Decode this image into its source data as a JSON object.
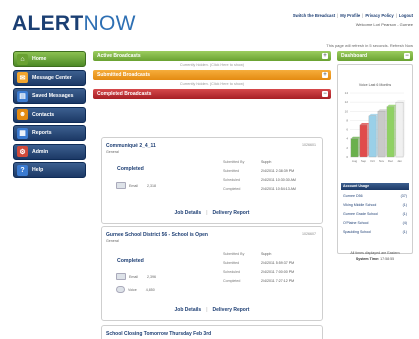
{
  "brand": {
    "name_part1": "ALERT",
    "name_part2": "NOW"
  },
  "header": {
    "links": [
      "Switch the Breadcast",
      "My Profile",
      "Privacy Policy",
      "Logout"
    ],
    "welcome": "Welcome Lori Pearson - Gurnee",
    "refresh_note": "This page will refresh in 5 seconds. Refresh Now"
  },
  "nav": [
    {
      "label": "Home",
      "icon": "home-icon",
      "color": "#6aa232"
    },
    {
      "label": "Message Center",
      "icon": "megaphone-icon",
      "color": "#f2a52e"
    },
    {
      "label": "Saved Messages",
      "icon": "folder-icon",
      "color": "#3b7bd1"
    },
    {
      "label": "Contacts",
      "icon": "contacts-icon",
      "color": "#e48b12"
    },
    {
      "label": "Reports",
      "icon": "reports-icon",
      "color": "#3b7bd1"
    },
    {
      "label": "Admin",
      "icon": "admin-icon",
      "color": "#d04a3b"
    },
    {
      "label": "Help",
      "icon": "help-icon",
      "color": "#3b7bd1"
    }
  ],
  "sections": {
    "active": {
      "label": "Active Broadcasts",
      "sub": "Currently hidden. (Click Here to show)"
    },
    "submitted": {
      "label": "Submitted Broadcasts",
      "sub": "Currently hidden. (Click Here to show)"
    },
    "completed": {
      "label": "Completed Broadcasts"
    }
  },
  "broadcasts": [
    {
      "title": "Communiqué 2_4_11",
      "id": "1026601",
      "category": "General",
      "status": "Completed",
      "channels": [
        {
          "type": "Email",
          "count": "2,318",
          "icon": "email-icon"
        }
      ],
      "meta": [
        {
          "k": "Submitted By",
          "v": "Supph"
        },
        {
          "k": "Submitted",
          "v": "2/4/2011 2:38:39 PM"
        },
        {
          "k": "Scheduled",
          "v": "2/4/2011 10:30:30 AM"
        },
        {
          "k": "Completed",
          "v": "2/4/2011 10:54:13 AM"
        }
      ],
      "links": [
        "Job Details",
        "Delivery Report"
      ]
    },
    {
      "title": "Gurnee School District 56 - School is Open",
      "id": "1026607",
      "category": "General",
      "status": "Completed",
      "channels": [
        {
          "type": "Email",
          "count": "2,396",
          "icon": "email-icon"
        },
        {
          "type": "Voice",
          "count": "4,850",
          "icon": "phone-icon"
        }
      ],
      "meta": [
        {
          "k": "Submitted By",
          "v": "Supph"
        },
        {
          "k": "Submitted",
          "v": "2/4/2011 5:59:37 PM"
        },
        {
          "k": "Scheduled",
          "v": "2/4/2011 7:00:00 PM"
        },
        {
          "k": "Completed",
          "v": "2/4/2011 7:27:12 PM"
        }
      ],
      "links": [
        "Job Details",
        "Delivery Report"
      ]
    },
    {
      "title": "School Closing Tomorrow Thursday Feb 3rd",
      "id": ""
    }
  ],
  "dashboard": {
    "label": "Dashboard",
    "chart_title": "Voice Last 6 Months",
    "incidents_header": "Account Usage",
    "incidents": [
      {
        "name": "Gurnee D56",
        "count": "(37)"
      },
      {
        "name": "Viking Middle School",
        "count": "(1)"
      },
      {
        "name": "Gurnee Grade School",
        "count": "(1)"
      },
      {
        "name": "O'Plaine School",
        "count": "(4)"
      },
      {
        "name": "Spaulding School",
        "count": "(1)"
      }
    ],
    "footer_line1": "All times displayed are Eastern",
    "footer_label": "System Time:",
    "footer_time": "17:58:55"
  },
  "chart_data": {
    "type": "bar",
    "title": "Voice Last 6 Months",
    "categories": [
      "Aug",
      "Sep",
      "Oct",
      "Nov",
      "Dec",
      "Jan"
    ],
    "values": [
      4,
      7,
      9,
      10,
      11,
      12
    ],
    "ylim": [
      0,
      14
    ],
    "colors": [
      "#6ab04c",
      "#e04b4b",
      "#9ad0e8",
      "#c9c9c9",
      "#8fd163",
      "#f0f0f0"
    ]
  }
}
